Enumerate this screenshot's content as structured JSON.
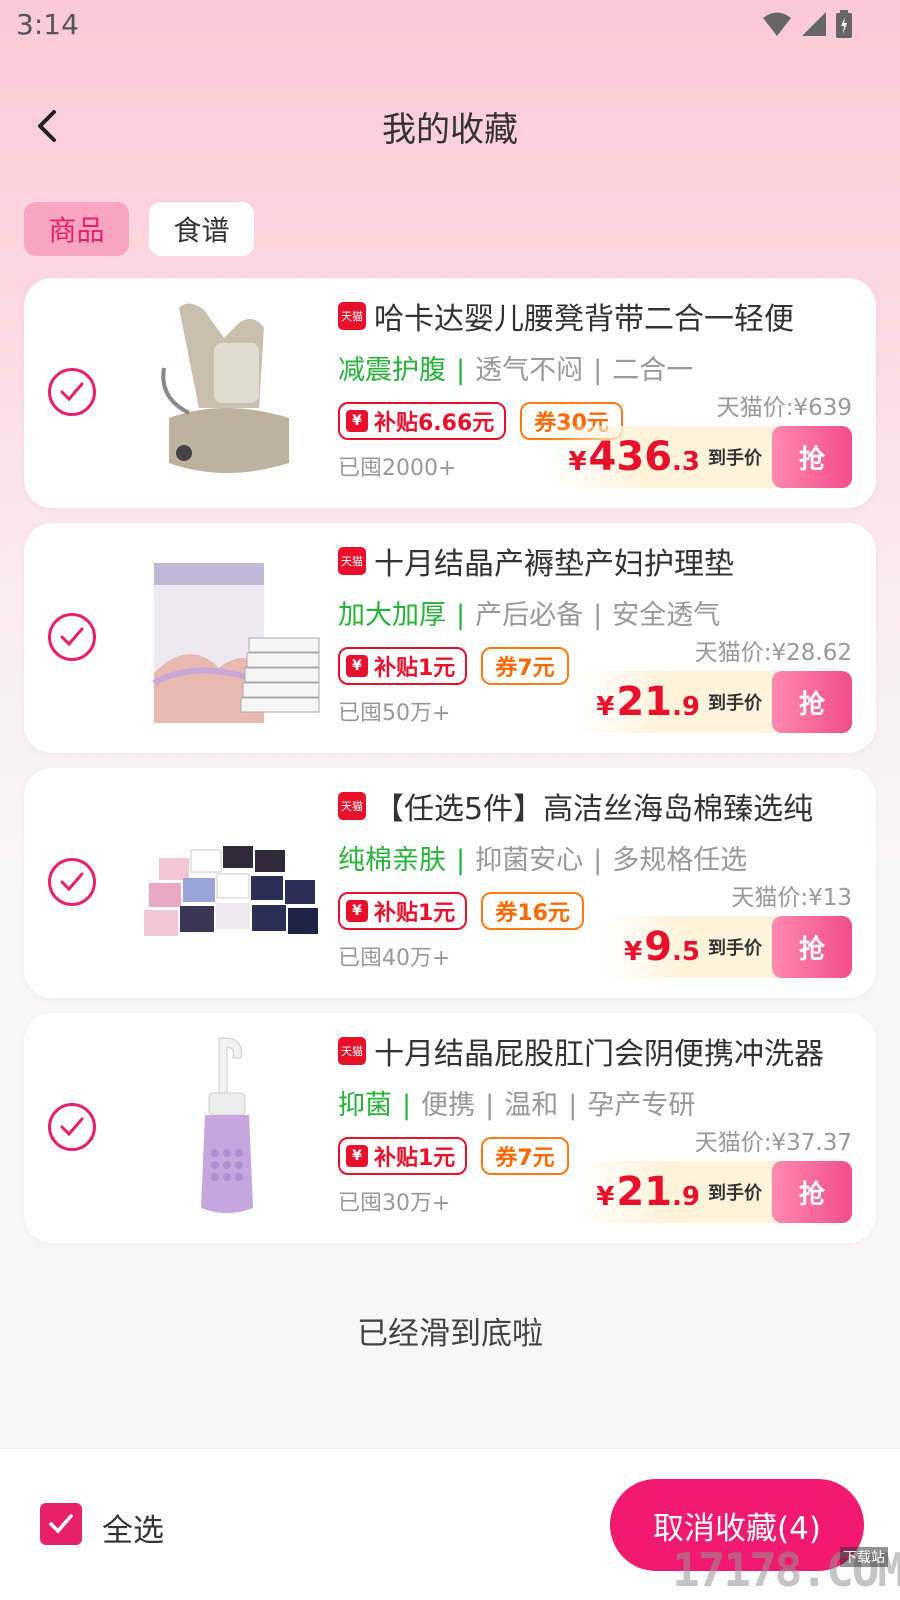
{
  "status_bar": {
    "time": "3:14"
  },
  "header": {
    "title": "我的收藏"
  },
  "tabs": [
    {
      "label": "商品",
      "active": true
    },
    {
      "label": "食谱",
      "active": false
    }
  ],
  "tmall_badge": "天猫",
  "products": [
    {
      "title": "哈卡达婴儿腰凳背带二合一轻便",
      "tag_primary": "减震护腹",
      "tags": [
        "透气不闷",
        "二合一"
      ],
      "subsidy": "补贴6.66元",
      "coupon": "券30元",
      "followers": "已囤2000+",
      "tmall_price": "天猫价:¥639",
      "price_yen": "¥",
      "price_int": "436",
      "price_dec": ".3",
      "price_label": "到手价",
      "grab": "抢",
      "image": "baby-carrier"
    },
    {
      "title": "十月结晶产褥垫产妇护理垫",
      "tag_primary": "加大加厚",
      "tags": [
        "产后必备",
        "安全透气"
      ],
      "subsidy": "补贴1元",
      "coupon": "券7元",
      "followers": "已囤50万+",
      "tmall_price": "天猫价:¥28.62",
      "price_yen": "¥",
      "price_int": "21",
      "price_dec": ".9",
      "price_label": "到手价",
      "grab": "抢",
      "image": "nursing-pad-pack"
    },
    {
      "title": "【任选5件】高洁丝海岛棉臻选纯",
      "tag_primary": "纯棉亲肤",
      "tags": [
        "抑菌安心",
        "多规格任选"
      ],
      "subsidy": "补贴1元",
      "coupon": "券16元",
      "followers": "已囤40万+",
      "tmall_price": "天猫价:¥13",
      "price_yen": "¥",
      "price_int": "9",
      "price_dec": ".5",
      "price_label": "到手价",
      "grab": "抢",
      "image": "sanitary-pad-stack"
    },
    {
      "title": "十月结晶屁股肛门会阴便携冲洗器",
      "tag_primary": "抑菌",
      "tags": [
        "便携",
        "温和",
        "孕产专研"
      ],
      "subsidy": "补贴1元",
      "coupon": "券7元",
      "followers": "已囤30万+",
      "tmall_price": "天猫价:¥37.37",
      "price_yen": "¥",
      "price_int": "21",
      "price_dec": ".9",
      "price_label": "到手价",
      "grab": "抢",
      "image": "portable-bidet-bottle"
    }
  ],
  "end_note": "已经滑到底啦",
  "footer": {
    "select_all": "全选",
    "cancel_button": "取消收藏(4)"
  },
  "watermark": {
    "main": "17178.COM",
    "small": "下载站"
  },
  "colors": {
    "accent": "#e8206a",
    "price_red": "#e8102a",
    "tag_green": "#27b239",
    "coupon_orange": "#ff6a00"
  }
}
